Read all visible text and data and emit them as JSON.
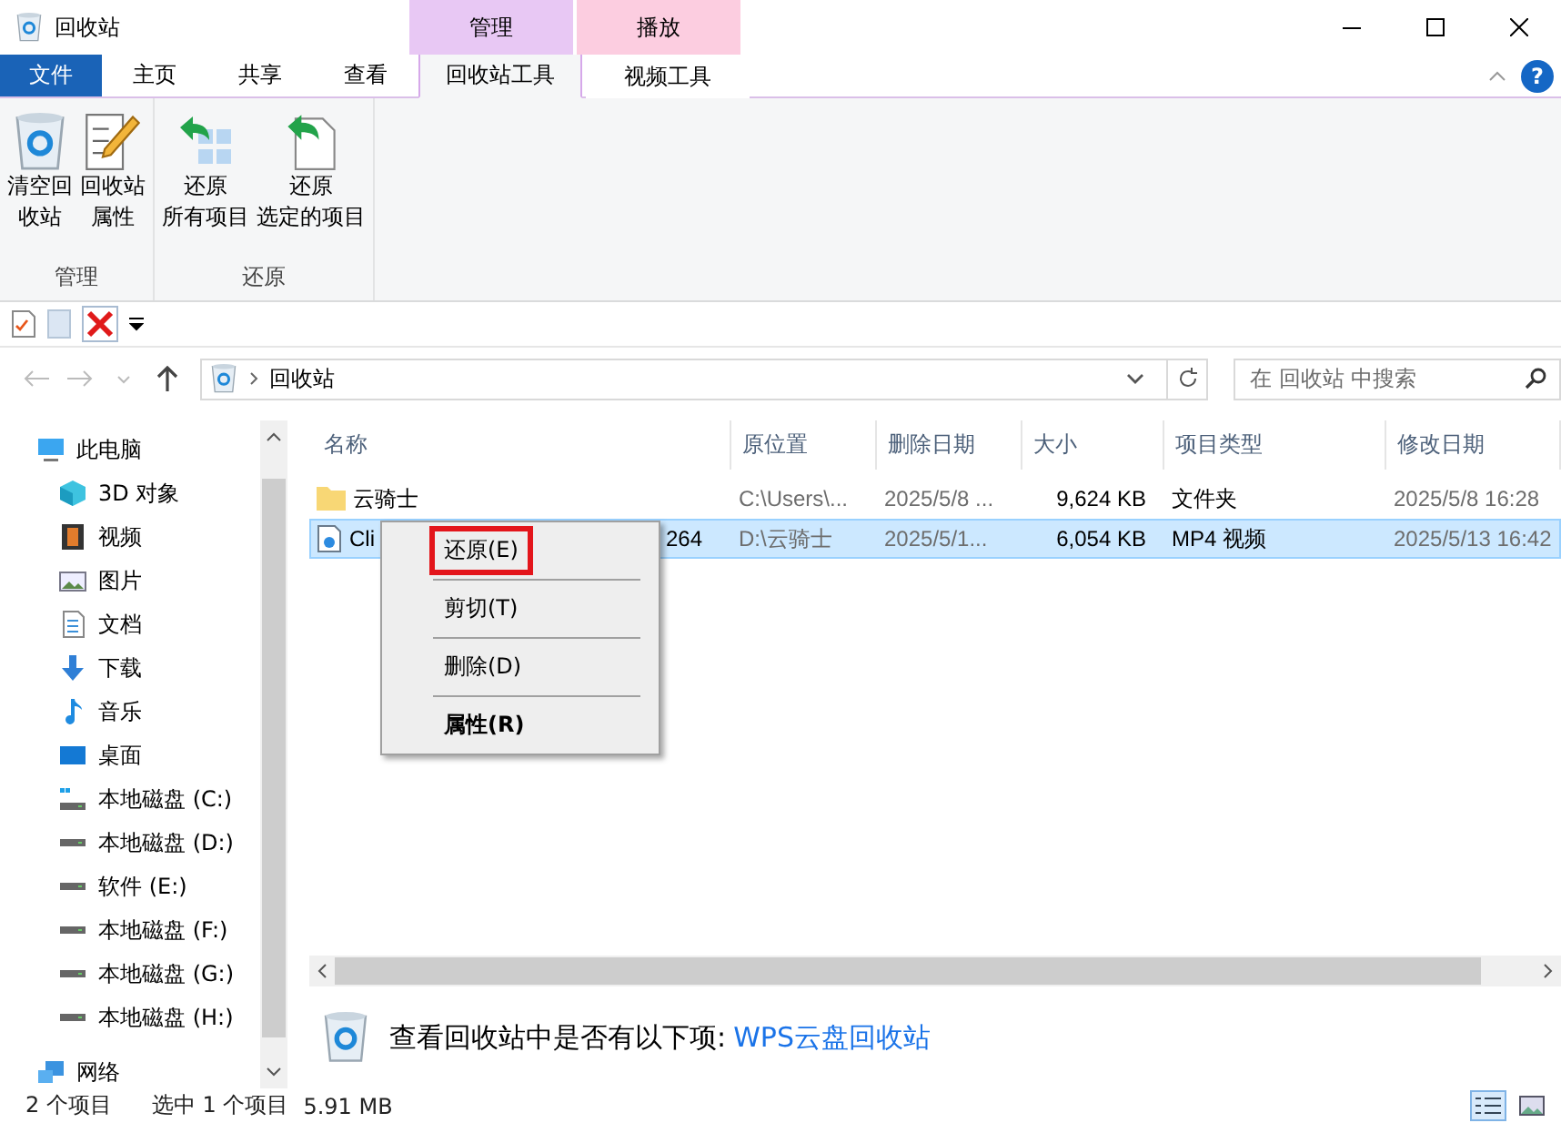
{
  "window": {
    "title": "回收站"
  },
  "context_tabs": [
    {
      "group": "管理",
      "label": "回收站工具",
      "color": "#e8c8f4",
      "selected": true
    },
    {
      "group": "播放",
      "label": "视频工具",
      "color": "#fccde0",
      "selected": false
    }
  ],
  "tabs": [
    {
      "label": "文件",
      "kind": "file",
      "selected": false
    },
    {
      "label": "主页",
      "kind": "tab",
      "selected": false
    },
    {
      "label": "共享",
      "kind": "tab",
      "selected": false
    },
    {
      "label": "查看",
      "kind": "tab",
      "selected": false
    }
  ],
  "help_button": "?",
  "ribbon_groups": [
    {
      "label": "管理",
      "buttons": [
        {
          "lines": [
            "清空回",
            "收站"
          ]
        },
        {
          "lines": [
            "回收站",
            "属性"
          ]
        }
      ]
    },
    {
      "label": "还原",
      "buttons": [
        {
          "lines": [
            "还原",
            "所有项目"
          ]
        },
        {
          "lines": [
            "还原",
            "选定的项目"
          ]
        }
      ]
    }
  ],
  "address": {
    "location": "回收站",
    "search_placeholder": "在 回收站 中搜索"
  },
  "sidebar": {
    "items": [
      {
        "label": "此电脑",
        "children": [
          {
            "label": "3D 对象"
          },
          {
            "label": "视频"
          },
          {
            "label": "图片"
          },
          {
            "label": "文档"
          },
          {
            "label": "下载"
          },
          {
            "label": "音乐"
          },
          {
            "label": "桌面"
          },
          {
            "label": "本地磁盘 (C:)"
          },
          {
            "label": "本地磁盘 (D:)"
          },
          {
            "label": "软件 (E:)"
          },
          {
            "label": "本地磁盘 (F:)"
          },
          {
            "label": "本地磁盘 (G:)"
          },
          {
            "label": "本地磁盘 (H:)"
          }
        ]
      },
      {
        "label": "网络"
      }
    ]
  },
  "table": {
    "columns": [
      "名称",
      "原位置",
      "删除日期",
      "大小",
      "项目类型",
      "修改日期"
    ],
    "rows": [
      {
        "kind": "folder",
        "selected": false,
        "cells": [
          "云骑士",
          "C:\\Users\\...",
          "2025/5/8 ...",
          "9,624 KB",
          "文件夹",
          "2025/5/8 16:28"
        ]
      },
      {
        "kind": "video",
        "selected": true,
        "cells": [
          "Cli",
          "D:\\云骑士",
          "2025/5/1...",
          "6,054 KB",
          "MP4 视频",
          "2025/5/13 16:42"
        ],
        "name_tail": "264"
      }
    ]
  },
  "context_menu": [
    {
      "label": "还原(E)",
      "outlined": true,
      "bold": false
    },
    {
      "label": "剪切(T)",
      "outlined": false,
      "bold": false
    },
    {
      "label": "删除(D)",
      "outlined": false,
      "bold": false
    },
    {
      "label": "属性(R)",
      "outlined": false,
      "bold": true
    }
  ],
  "hint": {
    "text": "查看回收站中是否有以下项:",
    "link": "WPS云盘回收站"
  },
  "status_bar": {
    "count": "2 个项目",
    "selection": "选中 1 个项目",
    "size": "5.91 MB"
  }
}
